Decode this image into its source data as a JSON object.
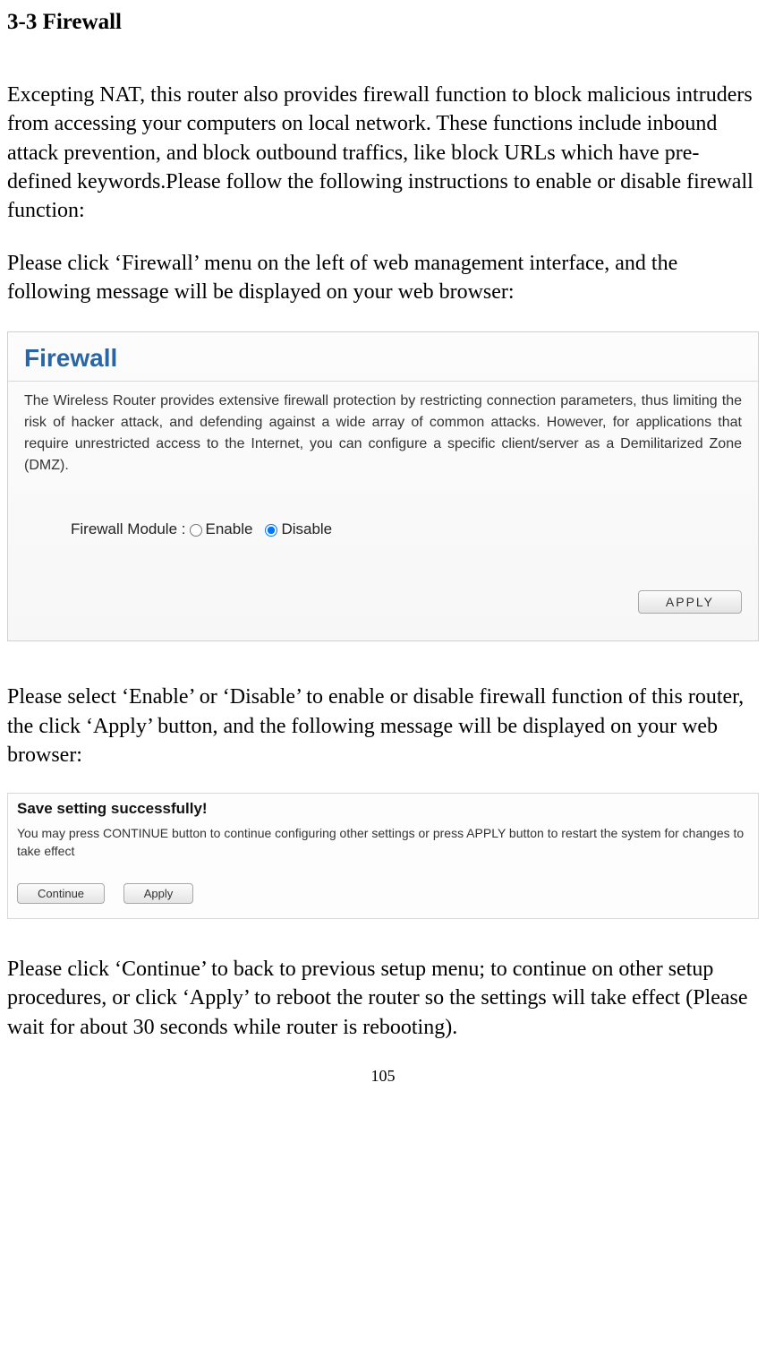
{
  "doc": {
    "heading": "3-3 Firewall",
    "p1": "Excepting NAT, this router also provides firewall function to block malicious intruders from accessing your computers on local network. These functions include inbound attack prevention, and block outbound traffics, like block URLs which have pre-defined keywords.Please follow the following instructions to enable or disable firewall function:",
    "p2": "Please click ‘Firewall’ menu on the left of web management interface, and the following message will be displayed on your web browser:",
    "p3": "Please select ‘Enable’ or ‘Disable’ to enable or disable firewall function of this router, the click ‘Apply’ button, and the following message will be displayed on your web browser:",
    "p4": "Please click ‘Continue’ to back to previous setup menu; to continue on other setup procedures, or click ‘Apply’ to reboot the router so the settings will take effect (Please wait for about 30 seconds while router is rebooting).",
    "page_number": "105"
  },
  "panel1": {
    "title": "Firewall",
    "desc": "The Wireless Router provides extensive firewall protection by restricting connection parameters, thus limiting the risk of hacker attack, and defending against a wide array of common attacks. However, for applications that require unrestricted access to the Internet, you can configure a specific client/server as a Demilitarized Zone (DMZ).",
    "label": "Firewall Module :",
    "enable_label": "Enable",
    "disable_label": "Disable",
    "selected": "disable",
    "apply_label": "APPLY"
  },
  "panel2": {
    "title": "Save setting successfully!",
    "desc": "You may press CONTINUE button to continue configuring other settings or press APPLY button to restart the system for changes to take effect",
    "continue_label": "Continue",
    "apply_label": "Apply"
  }
}
